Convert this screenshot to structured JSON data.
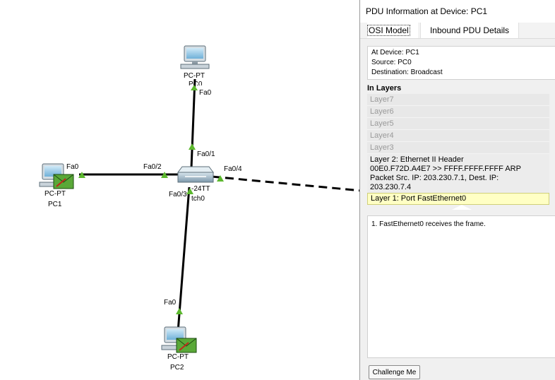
{
  "devices": {
    "pc0": {
      "type": "PC-PT",
      "name": "PC0",
      "port": "Fa0"
    },
    "pc1": {
      "type": "PC-PT",
      "name": "PC1",
      "port": "Fa0"
    },
    "pc2": {
      "type": "PC-PT",
      "name": "PC2",
      "port": "Fa0"
    },
    "switch0": {
      "type_visible": "-24TT",
      "name_visible": "tch0",
      "ports": {
        "p1": "Fa0/1",
        "p2": "Fa0/2",
        "p3": "Fa0/3",
        "p4": "Fa0/4"
      }
    },
    "pc0_name_partial": "PC0"
  },
  "pdu_window": {
    "title": "PDU Information at Device: PC1",
    "tabs": [
      "OSI Model",
      "Inbound PDU Details"
    ],
    "info": {
      "at_device": "At Device: PC1",
      "source": "Source: PC0",
      "destination": "Destination: Broadcast"
    },
    "in_layers_heading": "In Layers",
    "layers": [
      "Layer7",
      "Layer6",
      "Layer5",
      "Layer4",
      "Layer3"
    ],
    "layer2": {
      "line1": "Layer 2: Ethernet II Header",
      "line2": "00E0.F72D.A4E7 >> FFFF.FFFF.FFFF ARP",
      "line3": "Packet Src. IP: 203.230.7.1, Dest. IP:",
      "line4": "203.230.7.4"
    },
    "layer1": "Layer 1: Port FastEthernet0",
    "description": "1. FastEthernet0 receives the frame.",
    "challenge_button": "Challenge Me"
  },
  "colors": {
    "link": "#000000",
    "port_up": "#5cb82e",
    "envelope": "#5aa838",
    "selected_layer": "#ffffc4"
  }
}
